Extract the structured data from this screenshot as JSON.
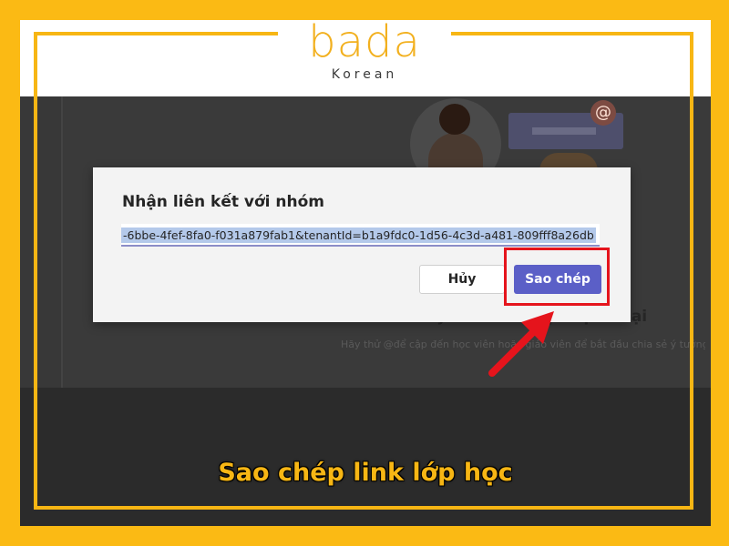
{
  "brand": {
    "logo": "bada",
    "sub": "Korean",
    "accent_color": "#f7b614"
  },
  "dialog": {
    "title": "Nhận liên kết với nhóm",
    "link_value": "-6bbe-4fef-8fa0-f031a879fab1&tenantId=b1a9fdc0-1d56-4c3d-a481-809fff8a26db",
    "cancel_label": "Hủy",
    "copy_label": "Sao chép",
    "primary_color": "#5b5fc7"
  },
  "background": {
    "heading": "Hãy bắt đầu cuộc hội thoại",
    "subtext": "Hãy thử @để cập đến học viên hoặc giáo viên để bắt đầu chia sẻ ý tưởng."
  },
  "caption": "Sao chép link lớp học"
}
